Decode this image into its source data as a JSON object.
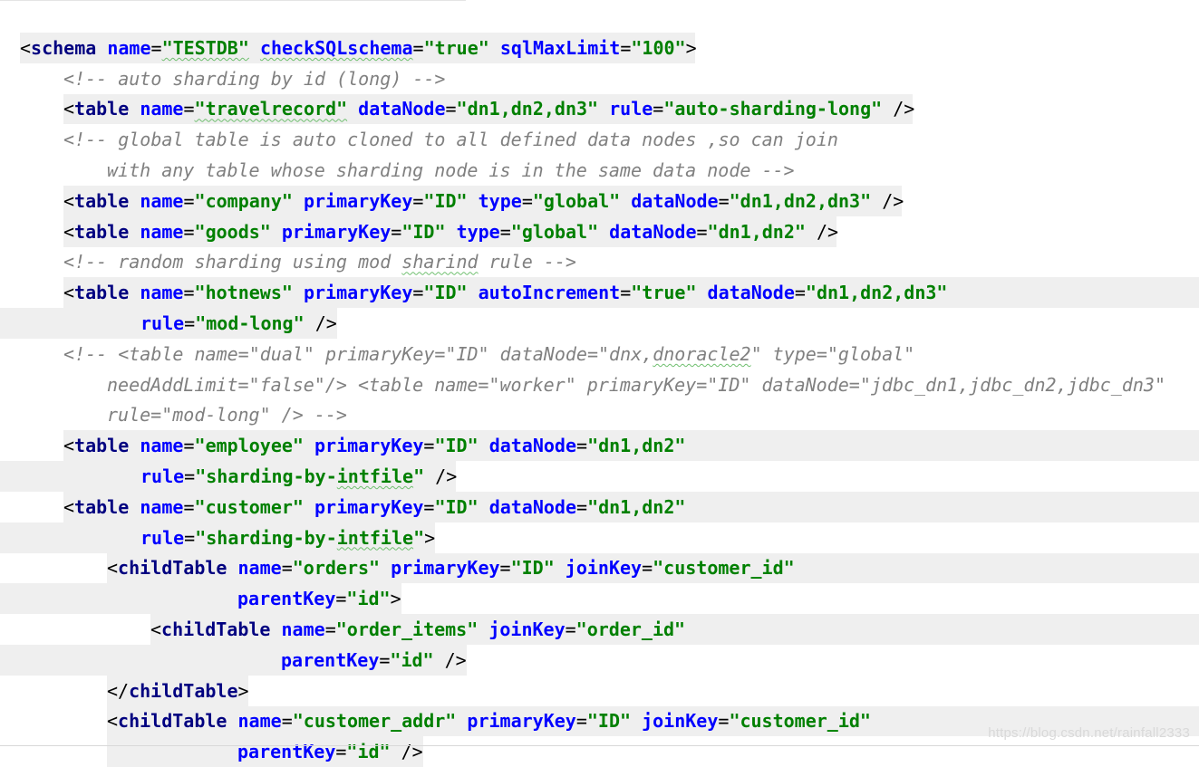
{
  "watermark": "https://blog.csdn.net/rainfall2333",
  "colors": {
    "tag": "#000080",
    "attribute": "#0000ff",
    "value": "#008000",
    "comment": "#808080",
    "highlight": "#efefef",
    "squiggle": "#6fbf6f"
  },
  "code_lines": [
    {
      "tokens": [
        {
          "t": "punc",
          "s": "<"
        },
        {
          "t": "tag",
          "s": "schema"
        },
        {
          "t": "sp",
          "s": " "
        },
        {
          "t": "attr",
          "s": "name"
        },
        {
          "t": "eq",
          "s": "="
        },
        {
          "t": "val",
          "s": "\"TESTDB\"",
          "sq": 1
        },
        {
          "t": "sp",
          "s": " "
        },
        {
          "t": "attr",
          "s": "checkSQLschema",
          "sq": 1
        },
        {
          "t": "eq",
          "s": "="
        },
        {
          "t": "val",
          "s": "\"true\""
        },
        {
          "t": "sp",
          "s": " "
        },
        {
          "t": "attr",
          "s": "sqlMaxLimit"
        },
        {
          "t": "eq",
          "s": "="
        },
        {
          "t": "val",
          "s": "\"100\""
        },
        {
          "t": "punc",
          "s": ">"
        }
      ]
    },
    {
      "tokens": [
        {
          "t": "cmt",
          "s": "<!-- auto sharding by id (long) -->"
        }
      ]
    },
    {
      "tokens": [
        {
          "t": "punc",
          "s": "<"
        },
        {
          "t": "tag",
          "s": "table"
        },
        {
          "t": "sp",
          "s": " "
        },
        {
          "t": "attr",
          "s": "name"
        },
        {
          "t": "eq",
          "s": "="
        },
        {
          "t": "val",
          "s": "\"travelrecord\"",
          "sq": 1
        },
        {
          "t": "sp",
          "s": " "
        },
        {
          "t": "attr",
          "s": "dataNode"
        },
        {
          "t": "eq",
          "s": "="
        },
        {
          "t": "val",
          "s": "\"dn1,dn2,dn3\""
        },
        {
          "t": "sp",
          "s": " "
        },
        {
          "t": "attr",
          "s": "rule"
        },
        {
          "t": "eq",
          "s": "="
        },
        {
          "t": "val",
          "s": "\"auto-sharding-long\""
        },
        {
          "t": "sp",
          "s": " "
        },
        {
          "t": "punc",
          "s": "/>"
        }
      ]
    },
    {
      "tokens": [
        {
          "t": "cmt",
          "s": "<!-- global table is auto cloned to all defined data nodes ,so can join"
        }
      ]
    },
    {
      "tokens": [
        {
          "t": "cmt",
          "s": "with any table whose sharding node is in the same data node -->"
        }
      ]
    },
    {
      "tokens": [
        {
          "t": "punc",
          "s": "<"
        },
        {
          "t": "tag",
          "s": "table"
        },
        {
          "t": "sp",
          "s": " "
        },
        {
          "t": "attr",
          "s": "name"
        },
        {
          "t": "eq",
          "s": "="
        },
        {
          "t": "val",
          "s": "\"company\""
        },
        {
          "t": "sp",
          "s": " "
        },
        {
          "t": "attr",
          "s": "primaryKey"
        },
        {
          "t": "eq",
          "s": "="
        },
        {
          "t": "val",
          "s": "\"ID\""
        },
        {
          "t": "sp",
          "s": " "
        },
        {
          "t": "attr",
          "s": "type"
        },
        {
          "t": "eq",
          "s": "="
        },
        {
          "t": "val",
          "s": "\"global\""
        },
        {
          "t": "sp",
          "s": " "
        },
        {
          "t": "attr",
          "s": "dataNode"
        },
        {
          "t": "eq",
          "s": "="
        },
        {
          "t": "val",
          "s": "\"dn1,dn2,dn3\""
        },
        {
          "t": "sp",
          "s": " "
        },
        {
          "t": "punc",
          "s": "/>"
        }
      ]
    },
    {
      "tokens": [
        {
          "t": "punc",
          "s": "<"
        },
        {
          "t": "tag",
          "s": "table"
        },
        {
          "t": "sp",
          "s": " "
        },
        {
          "t": "attr",
          "s": "name"
        },
        {
          "t": "eq",
          "s": "="
        },
        {
          "t": "val",
          "s": "\"goods\""
        },
        {
          "t": "sp",
          "s": " "
        },
        {
          "t": "attr",
          "s": "primaryKey"
        },
        {
          "t": "eq",
          "s": "="
        },
        {
          "t": "val",
          "s": "\"ID\""
        },
        {
          "t": "sp",
          "s": " "
        },
        {
          "t": "attr",
          "s": "type"
        },
        {
          "t": "eq",
          "s": "="
        },
        {
          "t": "val",
          "s": "\"global\""
        },
        {
          "t": "sp",
          "s": " "
        },
        {
          "t": "attr",
          "s": "dataNode"
        },
        {
          "t": "eq",
          "s": "="
        },
        {
          "t": "val",
          "s": "\"dn1,dn2\""
        },
        {
          "t": "sp",
          "s": " "
        },
        {
          "t": "punc",
          "s": "/>"
        }
      ]
    },
    {
      "tokens": [
        {
          "t": "cmt",
          "s": "<!-- random sharding using mod "
        },
        {
          "t": "cmt",
          "s": "sharind",
          "sq": 1
        },
        {
          "t": "cmt",
          "s": " rule -->"
        }
      ]
    },
    {
      "tokens": [
        {
          "t": "punc",
          "s": "<"
        },
        {
          "t": "tag",
          "s": "table"
        },
        {
          "t": "sp",
          "s": " "
        },
        {
          "t": "attr",
          "s": "name"
        },
        {
          "t": "eq",
          "s": "="
        },
        {
          "t": "val",
          "s": "\"hotnews\""
        },
        {
          "t": "sp",
          "s": " "
        },
        {
          "t": "attr",
          "s": "primaryKey"
        },
        {
          "t": "eq",
          "s": "="
        },
        {
          "t": "val",
          "s": "\"ID\""
        },
        {
          "t": "sp",
          "s": " "
        },
        {
          "t": "attr",
          "s": "autoIncrement"
        },
        {
          "t": "eq",
          "s": "="
        },
        {
          "t": "val",
          "s": "\"true\""
        },
        {
          "t": "sp",
          "s": " "
        },
        {
          "t": "attr",
          "s": "dataNode"
        },
        {
          "t": "eq",
          "s": "="
        },
        {
          "t": "val",
          "s": "\"dn1,dn2,dn3\""
        }
      ]
    },
    {
      "tokens": [
        {
          "t": "attr",
          "s": "rule"
        },
        {
          "t": "eq",
          "s": "="
        },
        {
          "t": "val",
          "s": "\"mod-long\""
        },
        {
          "t": "sp",
          "s": " "
        },
        {
          "t": "punc",
          "s": "/>"
        }
      ]
    },
    {
      "tokens": [
        {
          "t": "cmt",
          "s": "<!-- <table name=\"dual\" primaryKey=\"ID\" dataNode=\"dnx,"
        },
        {
          "t": "cmt",
          "s": "dnoracle2",
          "sq": 1
        },
        {
          "t": "cmt",
          "s": "\" type=\"global\""
        }
      ]
    },
    {
      "tokens": [
        {
          "t": "cmt",
          "s": "needAddLimit=\"false\"/> <table name=\"worker\" primaryKey=\"ID\" dataNode=\"jdbc_dn1,jdbc_dn2,jdbc_dn3\""
        }
      ]
    },
    {
      "tokens": [
        {
          "t": "cmt",
          "s": "rule=\"mod-long\" /> -->"
        }
      ]
    },
    {
      "tokens": [
        {
          "t": "punc",
          "s": "<"
        },
        {
          "t": "tag",
          "s": "table"
        },
        {
          "t": "sp",
          "s": " "
        },
        {
          "t": "attr",
          "s": "name"
        },
        {
          "t": "eq",
          "s": "="
        },
        {
          "t": "val",
          "s": "\"employee\""
        },
        {
          "t": "sp",
          "s": " "
        },
        {
          "t": "attr",
          "s": "primaryKey"
        },
        {
          "t": "eq",
          "s": "="
        },
        {
          "t": "val",
          "s": "\"ID\""
        },
        {
          "t": "sp",
          "s": " "
        },
        {
          "t": "attr",
          "s": "dataNode"
        },
        {
          "t": "eq",
          "s": "="
        },
        {
          "t": "val",
          "s": "\"dn1,dn2\""
        }
      ]
    },
    {
      "tokens": [
        {
          "t": "attr",
          "s": "rule"
        },
        {
          "t": "eq",
          "s": "="
        },
        {
          "t": "val",
          "s": "\"sharding-by-"
        },
        {
          "t": "val",
          "s": "intfile",
          "sq": 1
        },
        {
          "t": "val",
          "s": "\""
        },
        {
          "t": "sp",
          "s": " "
        },
        {
          "t": "punc",
          "s": "/>"
        }
      ]
    },
    {
      "tokens": [
        {
          "t": "punc",
          "s": "<"
        },
        {
          "t": "tag",
          "s": "table"
        },
        {
          "t": "sp",
          "s": " "
        },
        {
          "t": "attr",
          "s": "name"
        },
        {
          "t": "eq",
          "s": "="
        },
        {
          "t": "val",
          "s": "\"customer\""
        },
        {
          "t": "sp",
          "s": " "
        },
        {
          "t": "attr",
          "s": "primaryKey"
        },
        {
          "t": "eq",
          "s": "="
        },
        {
          "t": "val",
          "s": "\"ID\""
        },
        {
          "t": "sp",
          "s": " "
        },
        {
          "t": "attr",
          "s": "dataNode"
        },
        {
          "t": "eq",
          "s": "="
        },
        {
          "t": "val",
          "s": "\"dn1,dn2\""
        }
      ]
    },
    {
      "tokens": [
        {
          "t": "attr",
          "s": "rule"
        },
        {
          "t": "eq",
          "s": "="
        },
        {
          "t": "val",
          "s": "\"sharding-by-"
        },
        {
          "t": "val",
          "s": "intfile",
          "sq": 1
        },
        {
          "t": "val",
          "s": "\""
        },
        {
          "t": "punc",
          "s": ">"
        }
      ]
    },
    {
      "tokens": [
        {
          "t": "punc",
          "s": "<"
        },
        {
          "t": "tag",
          "s": "childTable"
        },
        {
          "t": "sp",
          "s": " "
        },
        {
          "t": "attr",
          "s": "name"
        },
        {
          "t": "eq",
          "s": "="
        },
        {
          "t": "val",
          "s": "\"orders\""
        },
        {
          "t": "sp",
          "s": " "
        },
        {
          "t": "attr",
          "s": "primaryKey"
        },
        {
          "t": "eq",
          "s": "="
        },
        {
          "t": "val",
          "s": "\"ID\""
        },
        {
          "t": "sp",
          "s": " "
        },
        {
          "t": "attr",
          "s": "joinKey"
        },
        {
          "t": "eq",
          "s": "="
        },
        {
          "t": "val",
          "s": "\"customer_id\""
        }
      ]
    },
    {
      "tokens": [
        {
          "t": "attr",
          "s": "parentKey"
        },
        {
          "t": "eq",
          "s": "="
        },
        {
          "t": "val",
          "s": "\"id\""
        },
        {
          "t": "punc",
          "s": ">"
        }
      ]
    },
    {
      "tokens": [
        {
          "t": "punc",
          "s": "<"
        },
        {
          "t": "tag",
          "s": "childTable"
        },
        {
          "t": "sp",
          "s": " "
        },
        {
          "t": "attr",
          "s": "name"
        },
        {
          "t": "eq",
          "s": "="
        },
        {
          "t": "val",
          "s": "\"order_items\""
        },
        {
          "t": "sp",
          "s": " "
        },
        {
          "t": "attr",
          "s": "joinKey"
        },
        {
          "t": "eq",
          "s": "="
        },
        {
          "t": "val",
          "s": "\"order_id\""
        }
      ]
    },
    {
      "tokens": [
        {
          "t": "attr",
          "s": "parentKey"
        },
        {
          "t": "eq",
          "s": "="
        },
        {
          "t": "val",
          "s": "\"id\""
        },
        {
          "t": "sp",
          "s": " "
        },
        {
          "t": "punc",
          "s": "/>"
        }
      ]
    },
    {
      "tokens": [
        {
          "t": "punc",
          "s": "</"
        },
        {
          "t": "tag",
          "s": "childTable"
        },
        {
          "t": "punc",
          "s": ">"
        }
      ]
    },
    {
      "tokens": [
        {
          "t": "punc",
          "s": "<"
        },
        {
          "t": "tag",
          "s": "childTable"
        },
        {
          "t": "sp",
          "s": " "
        },
        {
          "t": "attr",
          "s": "name"
        },
        {
          "t": "eq",
          "s": "="
        },
        {
          "t": "val",
          "s": "\"customer_addr\""
        },
        {
          "t": "sp",
          "s": " "
        },
        {
          "t": "attr",
          "s": "primaryKey"
        },
        {
          "t": "eq",
          "s": "="
        },
        {
          "t": "val",
          "s": "\"ID\""
        },
        {
          "t": "sp",
          "s": " "
        },
        {
          "t": "attr",
          "s": "joinKey"
        },
        {
          "t": "eq",
          "s": "="
        },
        {
          "t": "val",
          "s": "\"customer_id\""
        }
      ]
    },
    {
      "tokens": [
        {
          "t": "attr",
          "s": "parentKey"
        },
        {
          "t": "eq",
          "s": "="
        },
        {
          "t": "val",
          "s": "\"id\""
        },
        {
          "t": "sp",
          "s": " "
        },
        {
          "t": "punc",
          "s": "/>"
        }
      ]
    }
  ]
}
